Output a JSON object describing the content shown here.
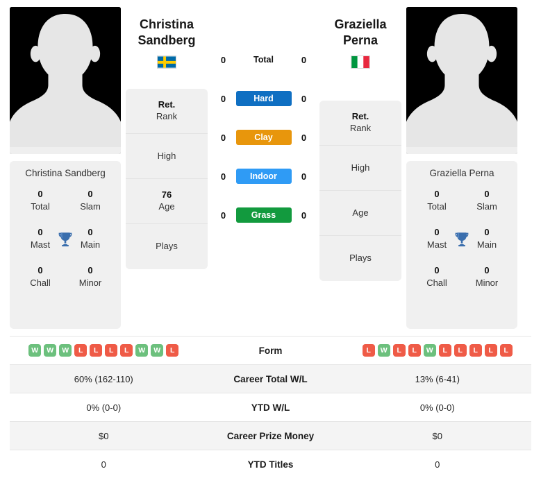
{
  "players": {
    "left": {
      "first_name": "Christina",
      "last_name": "Sandberg",
      "full_name": "Christina Sandberg",
      "country": "Sweden",
      "flag_icon": "sweden-flag-icon",
      "avatar_icon": "player-silhouette-icon",
      "titles": {
        "total_value": "0",
        "total_label": "Total",
        "slam_value": "0",
        "slam_label": "Slam",
        "mast_value": "0",
        "mast_label": "Mast",
        "main_value": "0",
        "main_label": "Main",
        "chall_value": "0",
        "chall_label": "Chall",
        "minor_value": "0",
        "minor_label": "Minor",
        "trophy_icon": "trophy-icon"
      },
      "info": [
        {
          "value": "Ret.",
          "label": "Rank"
        },
        {
          "value": "",
          "label": "High"
        },
        {
          "value": "76",
          "label": "Age"
        },
        {
          "value": "",
          "label": "Plays"
        }
      ],
      "surface_values": {
        "total": "0",
        "hard": "0",
        "clay": "0",
        "indoor": "0",
        "grass": "0"
      },
      "form": [
        "W",
        "W",
        "W",
        "L",
        "L",
        "L",
        "L",
        "W",
        "W",
        "L"
      ],
      "career_total_wl": "60% (162-110)",
      "ytd_wl": "0% (0-0)",
      "career_prize_money": "$0",
      "ytd_titles": "0"
    },
    "right": {
      "first_name": "Graziella",
      "last_name": "Perna",
      "full_name": "Graziella Perna",
      "country": "Italy",
      "flag_icon": "italy-flag-icon",
      "avatar_icon": "player-silhouette-icon",
      "titles": {
        "total_value": "0",
        "total_label": "Total",
        "slam_value": "0",
        "slam_label": "Slam",
        "mast_value": "0",
        "mast_label": "Mast",
        "main_value": "0",
        "main_label": "Main",
        "chall_value": "0",
        "chall_label": "Chall",
        "minor_value": "0",
        "minor_label": "Minor",
        "trophy_icon": "trophy-icon"
      },
      "info": [
        {
          "value": "Ret.",
          "label": "Rank"
        },
        {
          "value": "",
          "label": "High"
        },
        {
          "value": "",
          "label": "Age"
        },
        {
          "value": "",
          "label": "Plays"
        }
      ],
      "surface_values": {
        "total": "0",
        "hard": "0",
        "clay": "0",
        "indoor": "0",
        "grass": "0"
      },
      "form": [
        "L",
        "W",
        "L",
        "L",
        "W",
        "L",
        "L",
        "L",
        "L",
        "L"
      ],
      "career_total_wl": "13% (6-41)",
      "ytd_wl": "0% (0-0)",
      "career_prize_money": "$0",
      "ytd_titles": "0"
    }
  },
  "surfaces": [
    {
      "key": "total",
      "label": "Total",
      "color": "transparent",
      "text_color": "#111111"
    },
    {
      "key": "hard",
      "label": "Hard",
      "color": "#0f6fc2",
      "text_color": "#ffffff"
    },
    {
      "key": "clay",
      "label": "Clay",
      "color": "#e8960c",
      "text_color": "#ffffff"
    },
    {
      "key": "indoor",
      "label": "Indoor",
      "color": "#2f9bf5",
      "text_color": "#ffffff"
    },
    {
      "key": "grass",
      "label": "Grass",
      "color": "#129a3e",
      "text_color": "#ffffff"
    }
  ],
  "comparison_rows": [
    {
      "label": "Form"
    },
    {
      "label": "Career Total W/L"
    },
    {
      "label": "YTD W/L"
    },
    {
      "label": "Career Prize Money"
    },
    {
      "label": "YTD Titles"
    }
  ],
  "colors": {
    "win_badge": "#6cc07d",
    "loss_badge": "#ef5b47",
    "card_background": "#f0f0f0",
    "row_shade": "#f4f4f4",
    "trophy": "#3a6ead"
  }
}
